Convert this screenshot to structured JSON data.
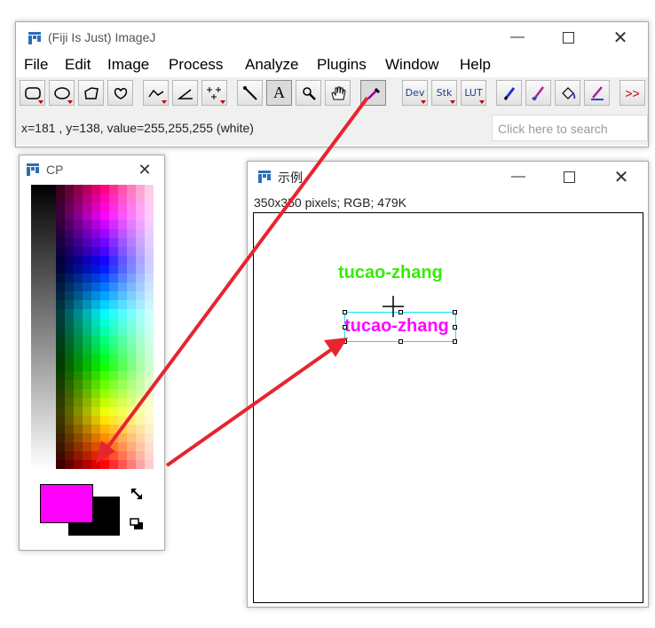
{
  "main_window": {
    "title": "(Fiji Is Just) ImageJ",
    "menus": [
      "File",
      "Edit",
      "Image",
      "Process",
      "Analyze",
      "Plugins",
      "Window",
      "Help"
    ],
    "toolbar": {
      "dev_label": "Dev",
      "stk_label": "Stk",
      "lut_label": "LUT",
      "more_label": ">>"
    },
    "status": "x=181 , y=138, value=255,255,255 (white)",
    "search_placeholder": "Click here to search"
  },
  "cp_window": {
    "title": "CP",
    "foreground_color": "#ff00ff",
    "background_color": "#000000"
  },
  "image_window": {
    "title": "示例",
    "info": "350x350 pixels; RGB; 479K",
    "text_green": "tucao-zhang",
    "text_magenta": "tucao-zhang",
    "text_green_color": "#33ee00",
    "text_magenta_color": "#ff00ff",
    "selection_color": "#00e5ff"
  },
  "annotation_color": "#e62530"
}
